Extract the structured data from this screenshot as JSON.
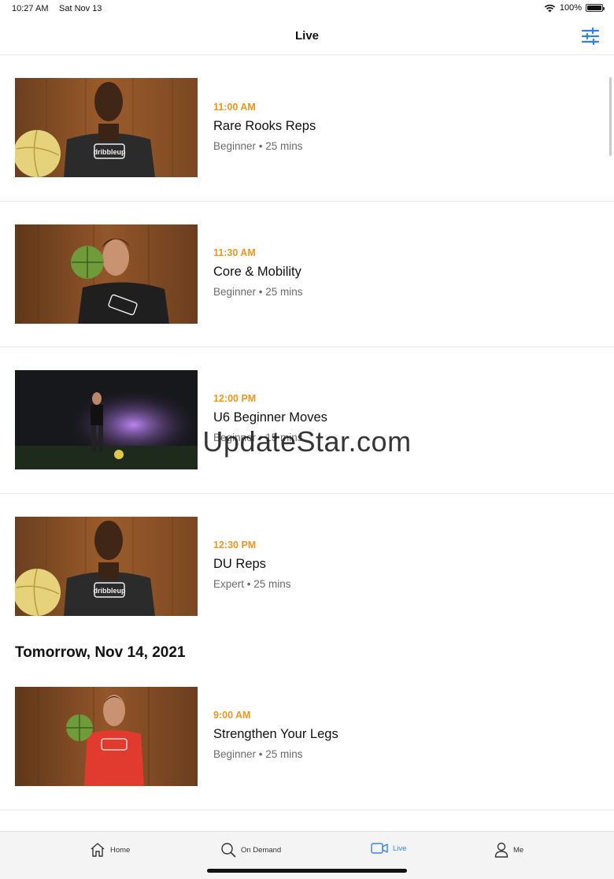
{
  "status": {
    "time": "10:27 AM",
    "date": "Sat Nov 13",
    "battery": "100%",
    "battery_level": 1.0
  },
  "header": {
    "title": "Live",
    "filter_icon": "sliders-icon",
    "accent": "#2f80ed"
  },
  "classes": [
    {
      "time": "11:00 AM",
      "title": "Rare Rooks Reps",
      "meta": "Beginner • 25 mins",
      "thumb": "instructor-yellow-ball"
    },
    {
      "time": "11:30 AM",
      "title": "Core & Mobility",
      "meta": "Beginner • 25 mins",
      "thumb": "instructor-green-ball"
    },
    {
      "time": "12:00 PM",
      "title": "U6 Beginner Moves",
      "meta": "Beginner • 15 mins",
      "thumb": "dark-studio-dribble"
    },
    {
      "time": "12:30 PM",
      "title": "DU Reps",
      "meta": "Expert • 25 mins",
      "thumb": "instructor-yellow-ball"
    }
  ],
  "tomorrow": {
    "heading": "Tomorrow, Nov 14, 2021",
    "classes": [
      {
        "time": "9:00 AM",
        "title": "Strengthen Your Legs",
        "meta": "Beginner • 25 mins",
        "thumb": "instructor-red-shirt"
      }
    ]
  },
  "watermark": "UpdateStar.com",
  "shirt_text": "dribbleup",
  "tabs": [
    {
      "label": "Home",
      "icon": "home-icon"
    },
    {
      "label": "On Demand",
      "icon": "search-icon"
    },
    {
      "label": "Live",
      "icon": "video-camera-icon",
      "active": true
    },
    {
      "label": "Me",
      "icon": "person-icon"
    }
  ],
  "colors": {
    "time_accent": "#f0961e",
    "active_tab": "#3b82f6"
  }
}
